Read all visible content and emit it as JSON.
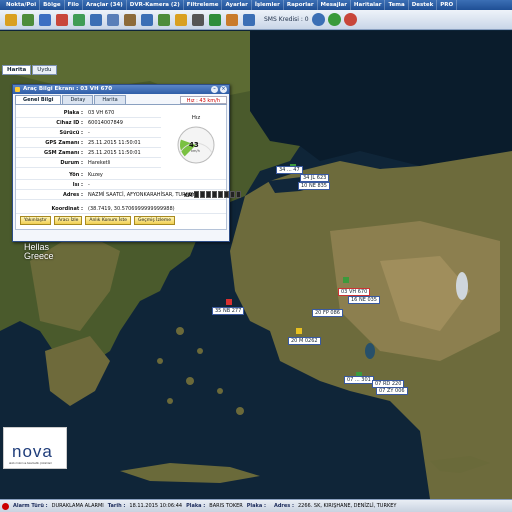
{
  "menu": [
    "Nokta/Poi",
    "Bölge",
    "Filo",
    "Araçlar (34)",
    "DVR-Kamera (2)",
    "Filtreleme",
    "Ayarlar",
    "İşlemler",
    "Raporlar",
    "Mesajlar",
    "Haritalar",
    "Tema",
    "Destek",
    "PRO"
  ],
  "toolbar": {
    "icons": [
      {
        "name": "network-icon",
        "color": "#d9a021"
      },
      {
        "name": "vehicle-list-icon",
        "color": "#4d8c3a"
      },
      {
        "name": "route-icon",
        "color": "#3d6fc2"
      },
      {
        "name": "region-icon",
        "color": "#c8463a"
      },
      {
        "name": "refresh-icon",
        "color": "#3f9c55"
      },
      {
        "name": "poi-icon",
        "color": "#3b6fb5"
      },
      {
        "name": "settings-icon",
        "color": "#5a7fb8"
      },
      {
        "name": "report-icon",
        "color": "#8c6b3a"
      },
      {
        "name": "mail-icon",
        "color": "#3b6fb5"
      },
      {
        "name": "export-icon",
        "color": "#4d8c3a"
      },
      {
        "name": "alarm-icon",
        "color": "#d9a021"
      },
      {
        "name": "camera-icon",
        "color": "#555555"
      },
      {
        "name": "map-icon",
        "color": "#2f8d3a"
      },
      {
        "name": "tools-icon",
        "color": "#c97b2a"
      },
      {
        "name": "help-icon",
        "color": "#3b6fb5"
      }
    ],
    "sms_label": "SMS Kredisi : 0"
  },
  "map": {
    "tabs": [
      "Harita",
      "Uydu"
    ],
    "place_labels": [
      {
        "text": "Hellas"
      },
      {
        "text": "Greece"
      }
    ],
    "vehicles": [
      {
        "label": "34 ... 47"
      },
      {
        "label": "34 JL 623"
      },
      {
        "label": "10 NE 835"
      },
      {
        "label": "03 VH 670"
      },
      {
        "label": "16 NE 035"
      },
      {
        "label": "35 NB 277"
      },
      {
        "label": "20 FP 086"
      },
      {
        "label": "20 M 0262"
      },
      {
        "label": "07 ... 301"
      },
      {
        "label": "07 RD 220"
      },
      {
        "label": "07 ZY 006"
      }
    ]
  },
  "panel": {
    "title": "Araç Bilgi Ekranı : 03 VH 670",
    "tabs": [
      "Genel Bilgi",
      "Detay",
      "Harita"
    ],
    "speed_badge": "Hız : 43 km/h",
    "rows": [
      {
        "k": "Plaka :",
        "v": "03 VH 670"
      },
      {
        "k": "Cihaz ID :",
        "v": "60014007849"
      },
      {
        "k": "Sürücü :",
        "v": "-"
      },
      {
        "k": "GPS Zamanı :",
        "v": "25.11.2015 11:50:01"
      },
      {
        "k": "GSM Zamanı :",
        "v": "25.11.2015 11:50:01"
      },
      {
        "k": "Durum :",
        "v": "Hareketli"
      },
      {
        "k": "Yön :",
        "v": "Kuzey"
      },
      {
        "k": "Isı :",
        "v": "-"
      },
      {
        "k": "Adres :",
        "v": "NAZMİ SAATCİ, AFYONKARAHİSAR, TURKEY"
      },
      {
        "k": "Koordinat :",
        "v": "(38.7419, 30.5706999999999988)"
      }
    ],
    "gauge": {
      "title": "Hız",
      "value": "43",
      "unit": "km/h",
      "max": 180,
      "fraction": 0.24
    },
    "km_label": "KM :",
    "buttons": [
      "Yakınlaştır",
      "Aracı İzle",
      "Anlık Konum İste",
      "Geçmiş İzleme"
    ]
  },
  "logo": {
    "word": "nova",
    "tagline": "akıllı mobil ve telematik çözümleri"
  },
  "status": {
    "alarm_type_label": "Alarm Türü :",
    "alarm_type": "DURAKLAMA ALARMI",
    "date_label": "Tarih :",
    "date": "18.11.2015 10:06:44",
    "plate_label": "Plaka :",
    "plate": "BARIS TOKER",
    "plate2_label": "Plaka :",
    "plate2": "",
    "address_label": "Adres :",
    "address": "2266. SK, KIRIŞHANE, DENİZLİ, TURKEY"
  }
}
